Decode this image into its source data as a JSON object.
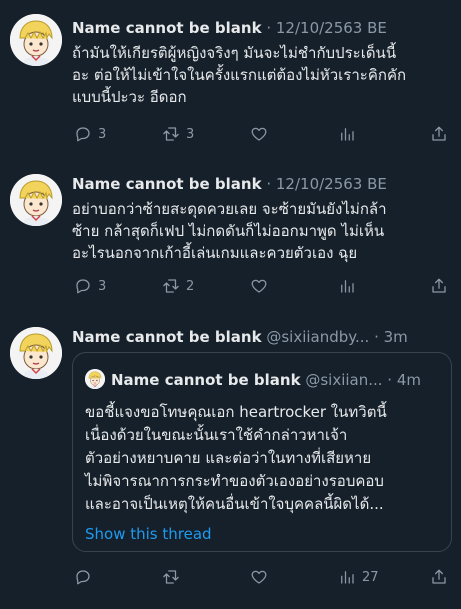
{
  "tweets": [
    {
      "name": "Name cannot be blank",
      "meta": "· 12/10/2563 BE",
      "lines": [
        "ถ้ามันให้เกียรติผู้หญิงจริงๆ มันจะไม่ชำกับประเด็นนี้",
        "อะ ต่อให้ไม่เข้าใจในครั้งแรกแต่ต้องไม่หัวเราะคิกคัก",
        "แบบนี้ปะวะ อีดอก"
      ],
      "replies": "3",
      "retweets": "3",
      "likes": ""
    },
    {
      "name": "Name cannot be blank",
      "meta": "· 12/10/2563 BE",
      "lines": [
        "อย่าบอกว่าซ้ายสะดุดควยเลย จะซ้ายมันยังไม่กล้า",
        "ซ้าย กล้าสุดก็เฟป ไม่กดดันก็ไม่ออกมาพูด ไม่เห็น",
        "อะไรนอกจากเก้าอี้เล่นเกมและควยตัวเอง ฉุย"
      ],
      "replies": "3",
      "retweets": "2",
      "likes": ""
    },
    {
      "name": "Name cannot be blank",
      "meta": "@sixiiandby... · 3m",
      "replies": "",
      "retweets": "",
      "likes": "",
      "views": "27"
    }
  ],
  "quote": {
    "name": "Name cannot be blank",
    "meta": "@sixiian... · 4m",
    "lines": [
      "ขอชี้แจงขอโทษคุณเอก heartrocker ในทวิตนี้",
      "เนื่องด้วยในขณะนั้นเราใช้คำกล่าวหาเจ้า",
      "ตัวอย่างหยาบคาย  และต่อว่าในทางที่เสียหาย",
      "ไม่พิจารณาการกระทำของตัวเองอย่างรอบคอบ",
      "และอาจเป็นเหตุให้คนอื่นเข้าใจบุคคลนี้ผิดได้..."
    ],
    "show_thread": "Show this thread"
  },
  "icons": {
    "reply": "reply-icon",
    "retweet": "retweet-icon",
    "like": "heart-icon",
    "views": "analytics-icon",
    "share": "share-icon"
  },
  "colors": {
    "background": "#15202b",
    "text": "#e7e9ea",
    "muted": "#8b98a5",
    "accent": "#1d9bf0",
    "border": "#38444d"
  }
}
